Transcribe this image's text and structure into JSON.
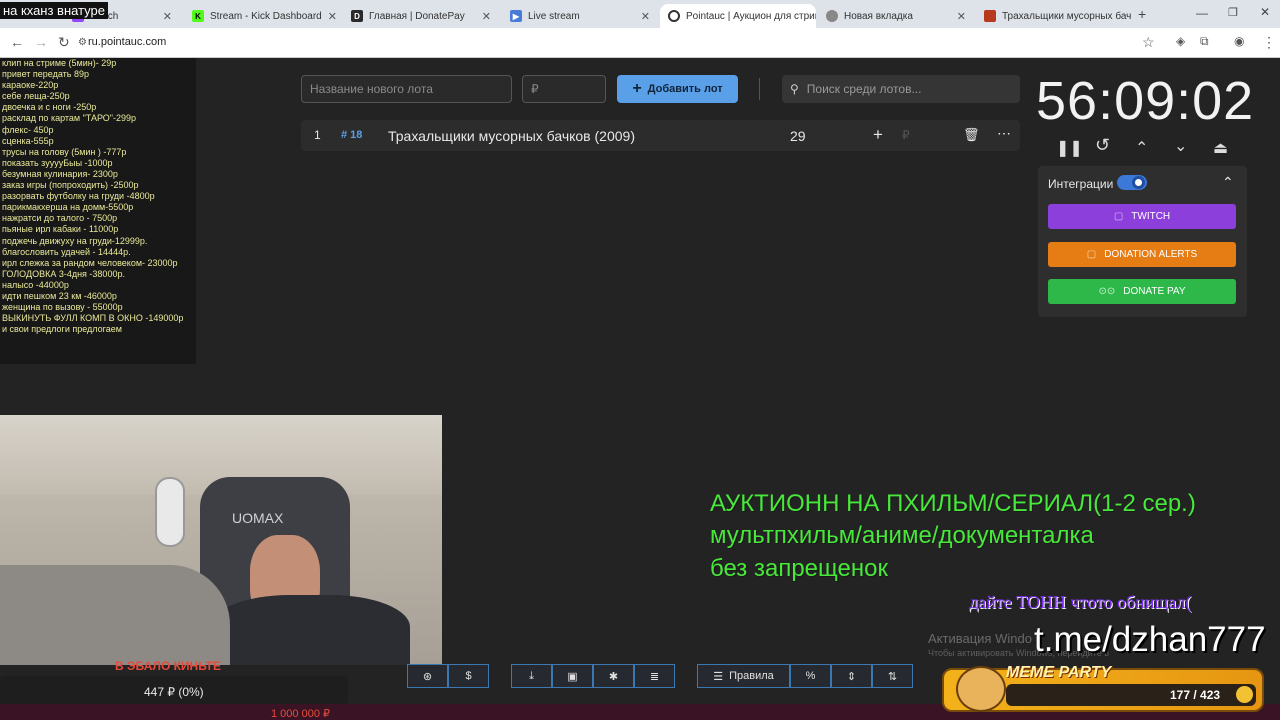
{
  "browser": {
    "tabs": [
      {
        "label": "Twitch",
        "fav_color": "#9146ff"
      },
      {
        "label": "Stream - Kick Dashboard",
        "fav_color": "#53fc18"
      },
      {
        "label": "Главная | DonatePay",
        "fav_color": "#2a2a2a"
      },
      {
        "label": "Live stream",
        "fav_color": "#4a7bd6"
      },
      {
        "label": "Pointauc | Аукцион для стрим",
        "fav_color": "#ffffff"
      },
      {
        "label": "Новая вкладка",
        "fav_color": "#888888"
      },
      {
        "label": "Трахальщики мусорных бачк",
        "fav_color": "#b83a1e"
      }
    ],
    "url": "ru.pointauc.com"
  },
  "overlay": {
    "title": "на кханз внатуре",
    "donation_list": [
      "клип на стриме (5мин)- 29р",
      "привет передать 89р",
      "караоке-220р",
      "себе леща-250р",
      "двоечка и с ноги -250р",
      "расклад по картам \"ТАРО\"-299р",
      "флекс- 450р",
      "сценка-555р",
      "трусы на голову (5мин ) -777р",
      "показать зууууБыы -1000р",
      "безумная кулинария- 2300р",
      "заказ игры (попроходить) -2500р",
      "разорвать футболку на груди -4800р",
      "парикмакхерша на домм-5500р",
      "нажрат­си до талого - 7500р",
      "пьяные ирл кабаки - 11000р",
      "поджечь движуху на груди-12999р.",
      "благословить удачей - 14444р.",
      "ирл слежка за рандом человеком- 23000р",
      "ГОЛОДОВКА 3-4дня -38000р.",
      "налысо -44000р",
      "идти пешком 23 км -46000р",
      "женщина по вызову - 55000р",
      "ВЫКИНУТЬ ФУЛЛ КОМП В ОКНО -149000р",
      "и свои предлоги предлогаем"
    ],
    "cam_caption": "В ЭБАЛО КИНЬТЕ",
    "donation_progress": "447 ₽ (0%)",
    "donation_goal": "1 000 000 ₽",
    "big_line1": "АУКТИОНН НА ПХИЛЬМ/СЕРИАЛ(1-2 сер.)",
    "big_line2": "мультпхильм/аниме/документалка",
    "big_line3": "без запрещенок",
    "purple_text": "дайте ТОНН чтото обнищал(",
    "telegram": "t.me/dzhan777",
    "windows_activation": "Активация Windo",
    "windows_activation_sub": "Чтобы активировать Windows, перейдите в",
    "meme_party": "MEME PARTY",
    "meme_counter": "177 / 423"
  },
  "auction": {
    "new_lot_placeholder": "Название нового лота",
    "amount_placeholder": "₽",
    "add_button": "Добавить лот",
    "search_placeholder": "Поиск среди лотов...",
    "lots": [
      {
        "index": "1",
        "id": "# 18",
        "name": "Трахальщики мусорных бачков (2009)",
        "amount": "29",
        "currency": "₽"
      }
    ],
    "timer": "56:09:02",
    "integrations_label": "Интеграции",
    "integrations_enabled": true,
    "integration_buttons": [
      {
        "label": "TWITCH",
        "color": "#8d3fdc"
      },
      {
        "label": "DONATION ALERTS",
        "color": "#e67c14"
      },
      {
        "label": "DONATE PAY",
        "color": "#2fb84a"
      }
    ],
    "rules_button": "Правила"
  },
  "colors": {
    "accent": "#5aa0e8",
    "green_text": "#47e83a",
    "purple_text": "#7b2bff"
  }
}
